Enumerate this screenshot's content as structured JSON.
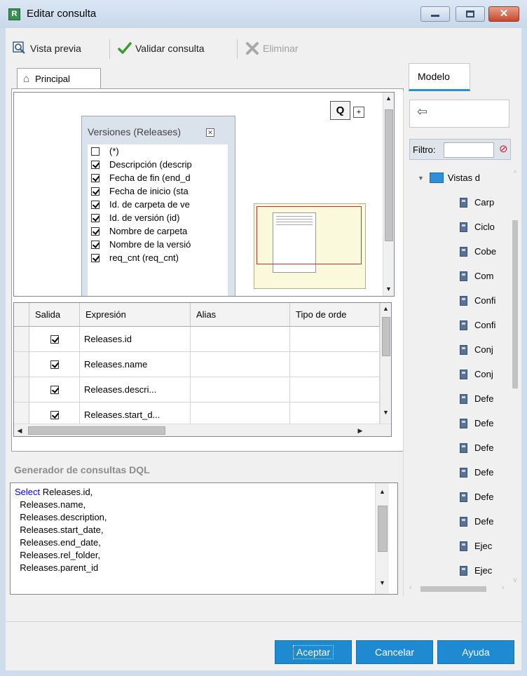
{
  "window": {
    "title": "Editar consulta"
  },
  "toolbar": {
    "preview_label": "Vista previa",
    "validate_label": "Validar consulta",
    "delete_label": "Eliminar"
  },
  "tabs": {
    "main_label": "Principal"
  },
  "diagram": {
    "zoom_button": "Q",
    "plus_button": "+",
    "table_title": "Versiones (Releases)",
    "fields": [
      {
        "label": "(*)",
        "checked": false
      },
      {
        "label": "Descripción (descrip",
        "checked": true
      },
      {
        "label": "Fecha de fin (end_d",
        "checked": true
      },
      {
        "label": "Fecha de inicio (sta",
        "checked": true
      },
      {
        "label": "Id. de carpeta de ve",
        "checked": true
      },
      {
        "label": "Id. de versión (id)",
        "checked": true
      },
      {
        "label": "Nombre de carpeta",
        "checked": true
      },
      {
        "label": "Nombre de la versió",
        "checked": true
      },
      {
        "label": "req_cnt (req_cnt)",
        "checked": true
      }
    ]
  },
  "grid": {
    "headers": [
      "Salida",
      "Expresión",
      "Alias",
      "Tipo de orde"
    ],
    "rows": [
      {
        "output": true,
        "expression": "Releases.id",
        "alias": "",
        "sort": ""
      },
      {
        "output": true,
        "expression": "Releases.name",
        "alias": "",
        "sort": ""
      },
      {
        "output": true,
        "expression": "Releases.descri...",
        "alias": "",
        "sort": ""
      },
      {
        "output": true,
        "expression": "Releases.start_d...",
        "alias": "",
        "sort": ""
      }
    ]
  },
  "sql_builder": {
    "title": "Generador de consultas DQL",
    "keyword": "Select",
    "first_line_rest": " Releases.id,",
    "lines": [
      "  Releases.name,",
      "  Releases.description,",
      "  Releases.start_date,",
      "  Releases.end_date,",
      "  Releases.rel_folder,",
      "  Releases.parent_id"
    ]
  },
  "model_panel": {
    "tab_label": "Modelo",
    "back_arrow": "⇦",
    "filter_label": "Filtro:",
    "filter_value": "",
    "root_label": "Vistas d",
    "items": [
      "Carp",
      "Ciclo",
      "Cobe",
      "Com",
      "Confi",
      "Confi",
      "Conj",
      "Conj",
      "Defe",
      "Defe",
      "Defe",
      "Defe",
      "Defe",
      "Defe",
      "Ejec",
      "Ejec"
    ]
  },
  "buttons": {
    "ok": "Aceptar",
    "cancel": "Cancelar",
    "help": "Ayuda"
  },
  "colors": {
    "accent": "#1e8ad2",
    "keyword": "#0000ee",
    "tab_underline": "#2e8fd0"
  }
}
